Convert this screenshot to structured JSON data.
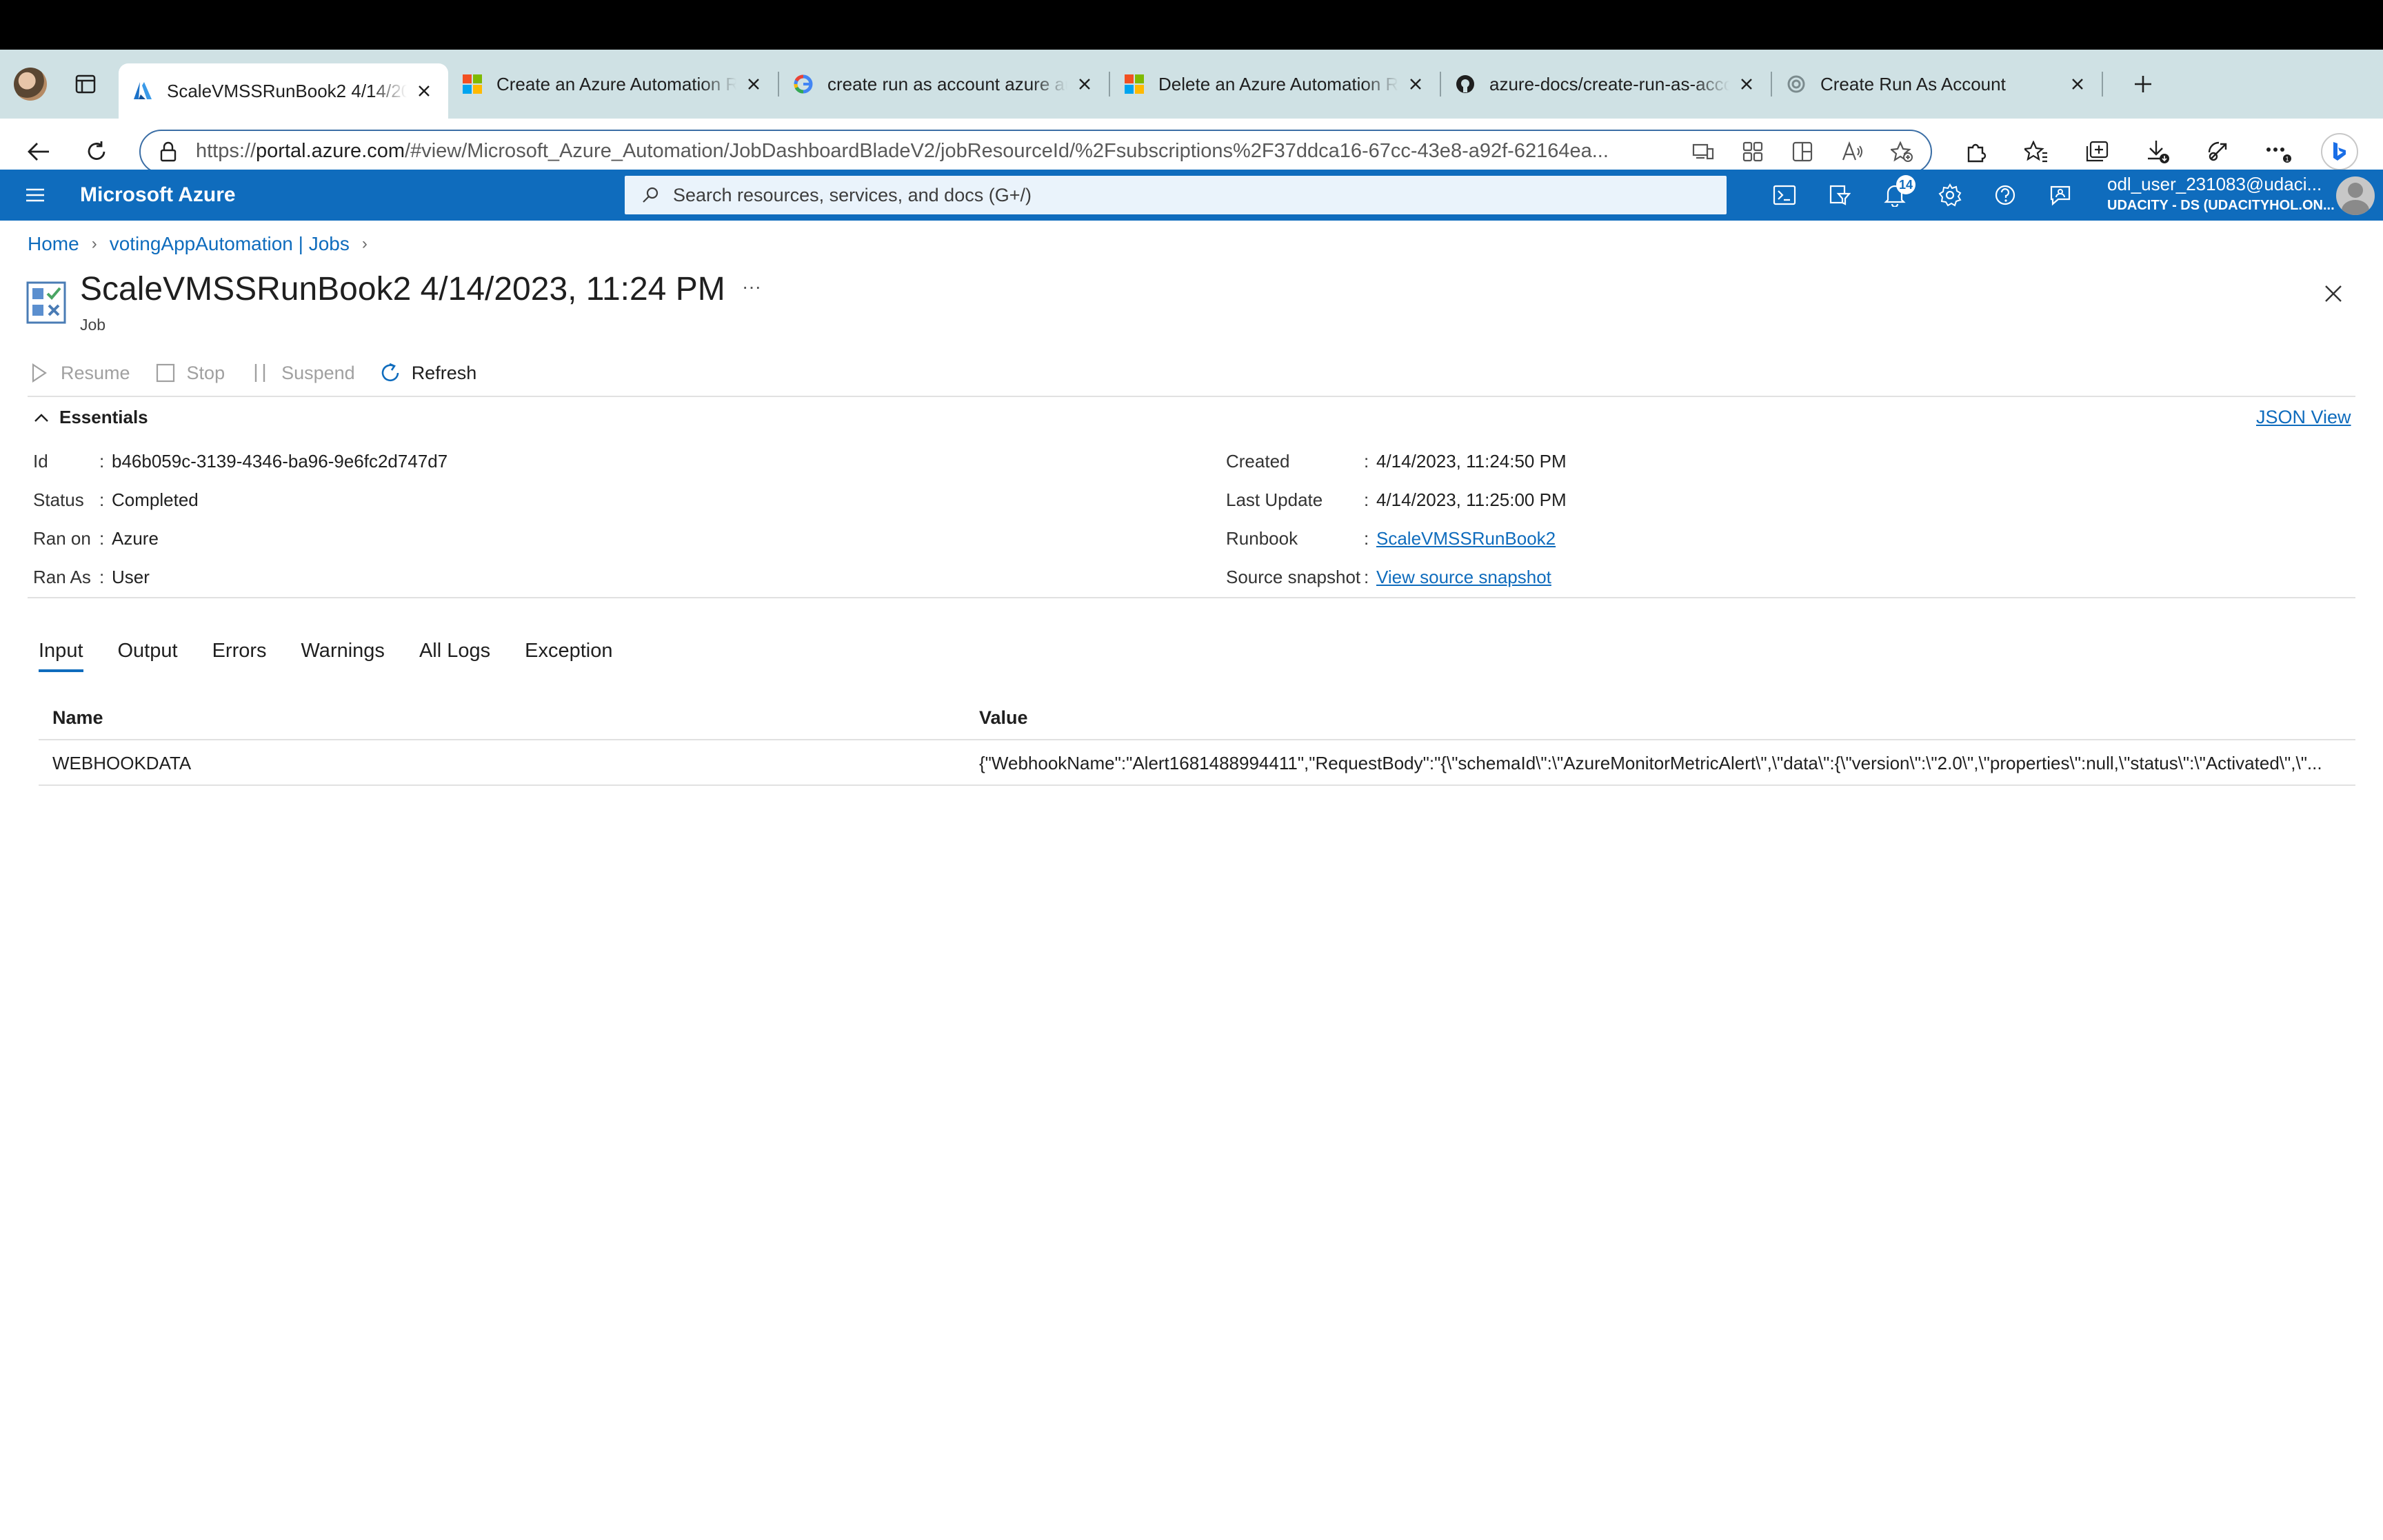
{
  "browser": {
    "tabs": [
      {
        "title": "ScaleVMSSRunBook2 4/14/2023, 11:24 PM",
        "favicon": "azure-logo",
        "active": true
      },
      {
        "title": "Create an Azure Automation Run As account",
        "favicon": "microsoft-logo",
        "active": false
      },
      {
        "title": "create run as account azure automation",
        "favicon": "google-logo",
        "active": false
      },
      {
        "title": "Delete an Azure Automation Run As account",
        "favicon": "microsoft-logo",
        "active": false
      },
      {
        "title": "azure-docs/create-run-as-account",
        "favicon": "github-logo",
        "active": false
      },
      {
        "title": "Create Run As Account",
        "favicon": "chatgpt-logo",
        "active": false
      }
    ],
    "url_prefix": "https://",
    "url_host": "portal.azure.com",
    "url_rest": "/#view/Microsoft_Azure_Automation/JobDashboardBladeV2/jobResourceId/%2Fsubscriptions%2F37ddca16-67cc-43e8-a92f-62164ea..."
  },
  "azure_header": {
    "brand": "Microsoft Azure",
    "search_placeholder": "Search resources, services, and docs (G+/)",
    "notification_count": "14",
    "account_name": "odl_user_231083@udaci...",
    "account_tenant": "UDACITY - DS (UDACITYHOL.ON..."
  },
  "breadcrumb": {
    "home": "Home",
    "parent": "votingAppAutomation | Jobs"
  },
  "blade": {
    "title": "ScaleVMSSRunBook2 4/14/2023, 11:24 PM",
    "subtitle": "Job",
    "more": "···"
  },
  "commands": {
    "resume": "Resume",
    "stop": "Stop",
    "suspend": "Suspend",
    "refresh": "Refresh"
  },
  "essentials": {
    "header": "Essentials",
    "json_view": "JSON View",
    "left": [
      {
        "key": "Id",
        "value": "b46b059c-3139-4346-ba96-9e6fc2d747d7"
      },
      {
        "key": "Status",
        "value": "Completed"
      },
      {
        "key": "Ran on",
        "value": "Azure"
      },
      {
        "key": "Ran As",
        "value": "User"
      }
    ],
    "right": [
      {
        "key": "Created",
        "value": "4/14/2023, 11:24:50 PM"
      },
      {
        "key": "Last Update",
        "value": "4/14/2023, 11:25:00 PM"
      },
      {
        "key": "Runbook",
        "value": "ScaleVMSSRunBook2"
      },
      {
        "key": "Source snapshot",
        "value": "View source snapshot"
      }
    ]
  },
  "tabs": [
    "Input",
    "Output",
    "Errors",
    "Warnings",
    "All Logs",
    "Exception"
  ],
  "input_table": {
    "headers": [
      "Name",
      "Value"
    ],
    "rows": [
      {
        "name": "WEBHOOKDATA",
        "value": "{\"WebhookName\":\"Alert1681488994411\",\"RequestBody\":\"{\\\"schemaId\\\":\\\"AzureMonitorMetricAlert\\\",\\\"data\\\":{\\\"version\\\":\\\"2.0\\\",\\\"properties\\\":null,\\\"status\\\":\\\"Activated\\\",\\\"..."
      }
    ]
  },
  "colors": {
    "azure_blue": "#0f6cbd",
    "tabbar_bg": "#cfe1e4",
    "divider": "#e1e1e1"
  }
}
